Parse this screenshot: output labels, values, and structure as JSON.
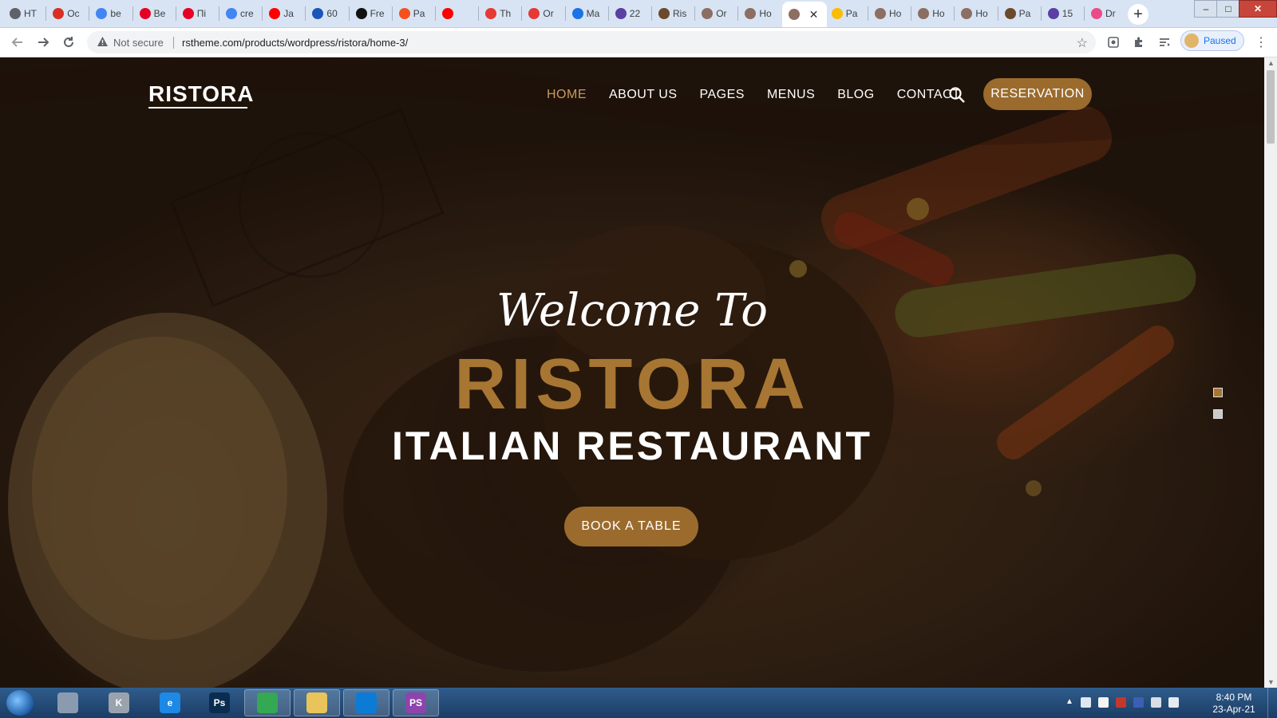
{
  "browser": {
    "tabs": [
      {
        "label": "HT",
        "favicon": "globe-icon",
        "color": "#5f6368"
      },
      {
        "label": "Oc",
        "favicon": "figure-icon",
        "color": "#d93025"
      },
      {
        "label": "be",
        "favicon": "google-icon",
        "color": "#4285f4"
      },
      {
        "label": "Be",
        "favicon": "pinterest-icon",
        "color": "#e60023"
      },
      {
        "label": "Пі",
        "favicon": "pinterest-icon",
        "color": "#e60023"
      },
      {
        "label": "cre",
        "favicon": "google-icon",
        "color": "#4285f4"
      },
      {
        "label": "Ja",
        "favicon": "youtube-icon",
        "color": "#ff0000"
      },
      {
        "label": "60",
        "favicon": "h-icon",
        "color": "#1a56b8"
      },
      {
        "label": "Fre",
        "favicon": "medium-icon",
        "color": "#111111"
      },
      {
        "label": "Pa",
        "favicon": "orange-icon",
        "color": "#f4511e"
      },
      {
        "label": "",
        "favicon": "youtube-icon",
        "color": "#ff0000"
      },
      {
        "label": "Th",
        "favicon": "u-icon",
        "color": "#e53935"
      },
      {
        "label": "Or",
        "favicon": "u-icon",
        "color": "#e53935"
      },
      {
        "label": "Ma",
        "favicon": "mail-icon",
        "color": "#1a73e8"
      },
      {
        "label": "22",
        "favicon": "colorlib-icon",
        "color": "#5b3fa3"
      },
      {
        "label": "Ris",
        "favicon": "photo-icon",
        "color": "#6b4a2b"
      },
      {
        "label": "Or",
        "favicon": "r-icon",
        "color": "#8d6e63"
      },
      {
        "label": "Ho",
        "favicon": "r-icon",
        "color": "#8d6e63"
      },
      {
        "label": "",
        "favicon": "r-icon",
        "color": "#8d6e63"
      },
      {
        "label": "Pa",
        "favicon": "chart-icon",
        "color": "#fbbc04"
      },
      {
        "label": "Ho",
        "favicon": "r-icon",
        "color": "#8d6e63"
      },
      {
        "label": "Ho",
        "favicon": "r-icon",
        "color": "#8d6e63"
      },
      {
        "label": "Ho",
        "favicon": "r-icon",
        "color": "#8d6e63"
      },
      {
        "label": "Pa",
        "favicon": "photo-icon",
        "color": "#6b4a2b"
      },
      {
        "label": "15",
        "favicon": "colorlib-icon",
        "color": "#5b3fa3"
      },
      {
        "label": "Dr",
        "favicon": "dribbble-icon",
        "color": "#ea4c89"
      }
    ],
    "active_tab_index": 18,
    "security_label": "Not secure",
    "url": "rstheme.com/products/wordpress/ristora/home-3/",
    "profile_status": "Paused"
  },
  "site": {
    "logo": "RISTORA",
    "nav": [
      {
        "label": "HOME",
        "active": true
      },
      {
        "label": "ABOUT US",
        "active": false
      },
      {
        "label": "PAGES",
        "active": false
      },
      {
        "label": "MENUS",
        "active": false
      },
      {
        "label": "BLOG",
        "active": false
      },
      {
        "label": "CONTACT",
        "active": false
      }
    ],
    "reservation_label": "RESERVATION",
    "hero": {
      "welcome": "Welcome To",
      "brand": "RISTORA",
      "subtitle": "ITALIAN RESTAURANT",
      "cta": "BOOK A TABLE"
    },
    "slider_active_index": 0,
    "accent_color": "#a77633"
  },
  "taskbar": {
    "apps": [
      {
        "name": "notepad",
        "label": "",
        "color": "#8a9bb0"
      },
      {
        "name": "k-app",
        "label": "K",
        "color": "#9aa3ad"
      },
      {
        "name": "internet-explorer",
        "label": "e",
        "color": "#1e88e5"
      },
      {
        "name": "photoshop",
        "label": "Ps",
        "color": "#0a2d4f"
      },
      {
        "name": "chrome",
        "label": "",
        "color": "#34a853"
      },
      {
        "name": "file-explorer",
        "label": "",
        "color": "#e8c45a"
      },
      {
        "name": "edge",
        "label": "",
        "color": "#0c7bd6"
      },
      {
        "name": "phpstorm",
        "label": "PS",
        "color": "#8e44ad"
      }
    ],
    "time": "8:40 PM",
    "date": "23-Apr-21"
  }
}
